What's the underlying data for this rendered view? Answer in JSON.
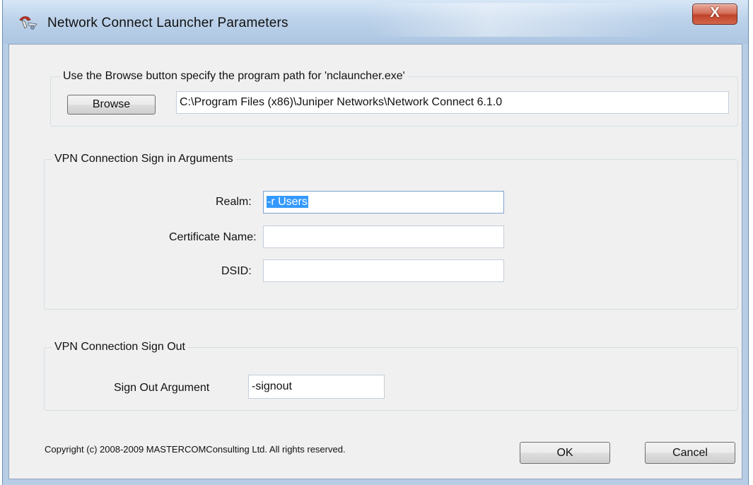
{
  "window": {
    "title": "Network Connect Launcher Parameters",
    "close_glyph": "X",
    "icon_name": "network-connect-app-icon"
  },
  "program_path_group": {
    "legend": "Use the Browse button specify the program path for 'nclauncher.exe'",
    "browse_label": "Browse",
    "path_value": "C:\\Program Files (x86)\\Juniper Networks\\Network Connect 6.1.0"
  },
  "sign_in_group": {
    "legend": "VPN Connection Sign in Arguments",
    "realm_label": "Realm:",
    "realm_value": "-r Users",
    "certificate_label": "Certificate Name:",
    "certificate_value": "",
    "dsid_label": "DSID:",
    "dsid_value": ""
  },
  "sign_out_group": {
    "legend": "VPN Connection Sign Out",
    "argument_label": "Sign Out Argument",
    "argument_value": "-signout"
  },
  "footer": {
    "copyright": "Copyright (c) 2008-2009 MASTERCOMConsulting Ltd. All rights reserved.",
    "ok_label": "OK",
    "cancel_label": "Cancel"
  },
  "colors": {
    "selection": "#3399ff",
    "close_button": "#c0432a",
    "dialog_bg": "#f0f0f0"
  }
}
